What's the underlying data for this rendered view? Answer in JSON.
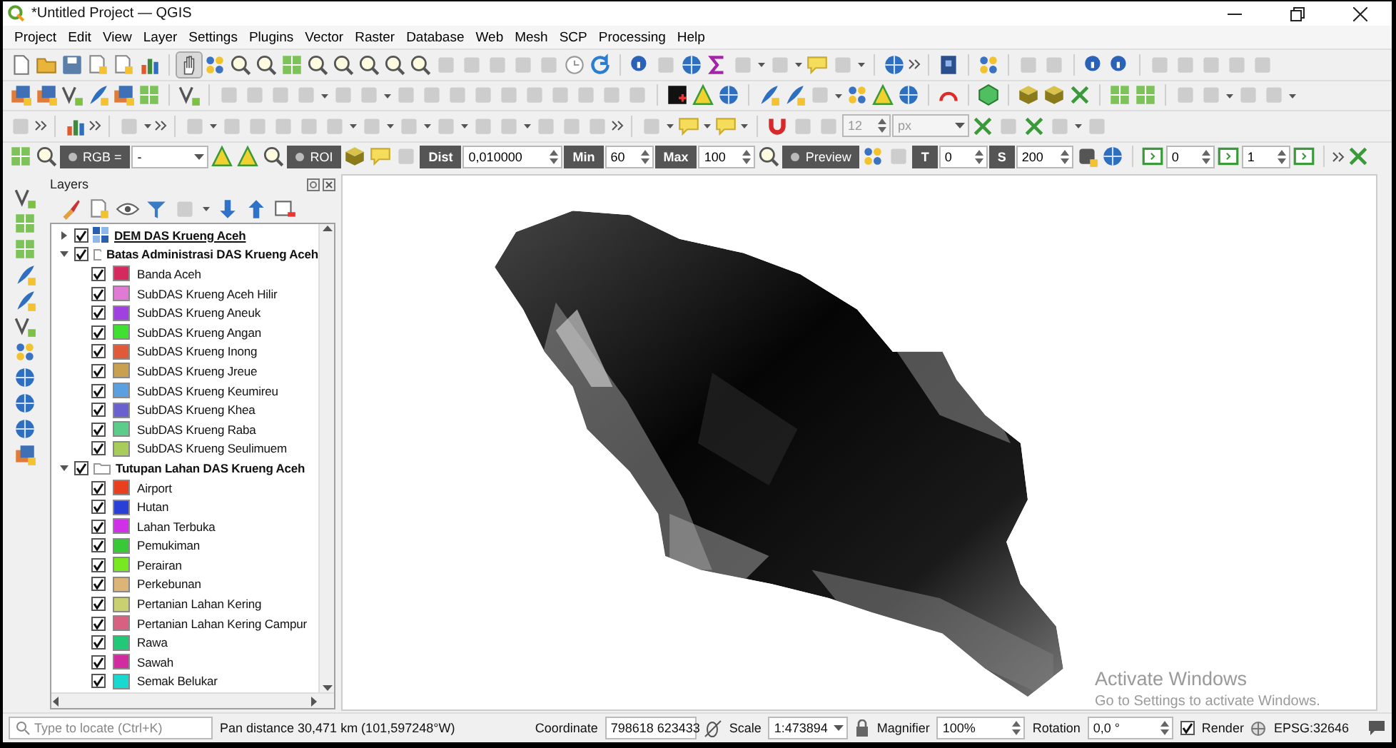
{
  "window": {
    "title": "*Untitled Project — QGIS"
  },
  "menu": [
    "Project",
    "Edit",
    "View",
    "Layer",
    "Settings",
    "Plugins",
    "Vector",
    "Raster",
    "Database",
    "Web",
    "Mesh",
    "SCP",
    "Processing",
    "Help"
  ],
  "snapping_toolbar": {
    "fields": [
      {
        "kind": "spin",
        "value": "12",
        "disabled": true
      },
      {
        "kind": "combo",
        "value": "px",
        "disabled": true
      }
    ]
  },
  "scp_toolbar": {
    "fields": [
      {
        "kind": "toggle",
        "label": "RGB ="
      },
      {
        "kind": "combo",
        "value": "-",
        "disabled": false
      },
      {
        "kind": "toggle",
        "label": "ROI"
      },
      {
        "kind": "chip",
        "label": "Dist"
      },
      {
        "kind": "spin",
        "value": "0,010000",
        "disabled": false
      },
      {
        "kind": "chip",
        "label": "Min"
      },
      {
        "kind": "spin",
        "value": "60",
        "disabled": false
      },
      {
        "kind": "chip",
        "label": "Max"
      },
      {
        "kind": "spin",
        "value": "100",
        "disabled": false
      },
      {
        "kind": "toggle",
        "label": "Preview"
      },
      {
        "kind": "chip",
        "label": "T"
      },
      {
        "kind": "spin",
        "value": "0",
        "disabled": false
      },
      {
        "kind": "chip",
        "label": "S"
      },
      {
        "kind": "spin",
        "value": "200",
        "disabled": false
      },
      {
        "kind": "spin",
        "value": "0",
        "disabled": false
      },
      {
        "kind": "spin",
        "value": "1",
        "disabled": false
      }
    ]
  },
  "layers_panel": {
    "title": "Layers",
    "layers": [
      {
        "name": "DEM DAS Krueng Aceh",
        "kind": "raster",
        "checked": true,
        "expanded": false
      },
      {
        "name": "Batas Administrasi DAS Krueng Aceh",
        "kind": "group",
        "checked": true,
        "expanded": true,
        "children": [
          {
            "name": "Banda Aceh",
            "checked": true,
            "color": "#d42a5e"
          },
          {
            "name": "SubDAS Krueng Aceh Hilir",
            "checked": true,
            "color": "#e07ad4"
          },
          {
            "name": "SubDAS Krueng Aneuk",
            "checked": true,
            "color": "#a040e0"
          },
          {
            "name": "SubDAS Krueng Angan",
            "checked": true,
            "color": "#40e030"
          },
          {
            "name": "SubDAS Krueng Inong",
            "checked": true,
            "color": "#e05a3a"
          },
          {
            "name": "SubDAS Krueng Jreue",
            "checked": true,
            "color": "#c8a050"
          },
          {
            "name": "SubDAS Krueng Keumireu",
            "checked": true,
            "color": "#5aa0e0"
          },
          {
            "name": "SubDAS Krueng Khea",
            "checked": true,
            "color": "#6a60d0"
          },
          {
            "name": "SubDAS Krueng Raba",
            "checked": true,
            "color": "#5ccc8a"
          },
          {
            "name": "SubDAS Krueng Seulimuem",
            "checked": true,
            "color": "#a8cc5a"
          }
        ]
      },
      {
        "name": "Tutupan Lahan DAS Krueng Aceh",
        "kind": "group",
        "checked": true,
        "expanded": true,
        "children": [
          {
            "name": "Airport",
            "checked": true,
            "color": "#e8401e"
          },
          {
            "name": "Hutan",
            "checked": true,
            "color": "#2a3ed8"
          },
          {
            "name": "Lahan Terbuka",
            "checked": true,
            "color": "#d030e8"
          },
          {
            "name": "Pemukiman",
            "checked": true,
            "color": "#38c838"
          },
          {
            "name": "Perairan",
            "checked": true,
            "color": "#78e820"
          },
          {
            "name": "Perkebunan",
            "checked": true,
            "color": "#dcb478"
          },
          {
            "name": "Pertanian Lahan Kering",
            "checked": true,
            "color": "#c8d070"
          },
          {
            "name": "Pertanian Lahan Kering Campur",
            "checked": true,
            "color": "#d86080"
          },
          {
            "name": "Rawa",
            "checked": true,
            "color": "#20c878"
          },
          {
            "name": "Sawah",
            "checked": true,
            "color": "#d02ca0"
          },
          {
            "name": "Semak Belukar",
            "checked": true,
            "color": "#18d8d0"
          }
        ]
      }
    ]
  },
  "watermark": {
    "title": "Activate Windows",
    "subtitle": "Go to Settings to activate Windows."
  },
  "status_bar": {
    "locate_placeholder": "Type to locate (Ctrl+K)",
    "message": "Pan distance 30,471 km (101,597248°W)",
    "coordinate_label": "Coordinate",
    "coordinate": "798618 623433",
    "scale_label": "Scale",
    "scale": "1:473894",
    "magnifier_label": "Magnifier",
    "magnifier": "100%",
    "rotation_label": "Rotation",
    "rotation": "0,0 °",
    "render_label": "Render",
    "render_checked": true,
    "crs": "EPSG:32646"
  }
}
